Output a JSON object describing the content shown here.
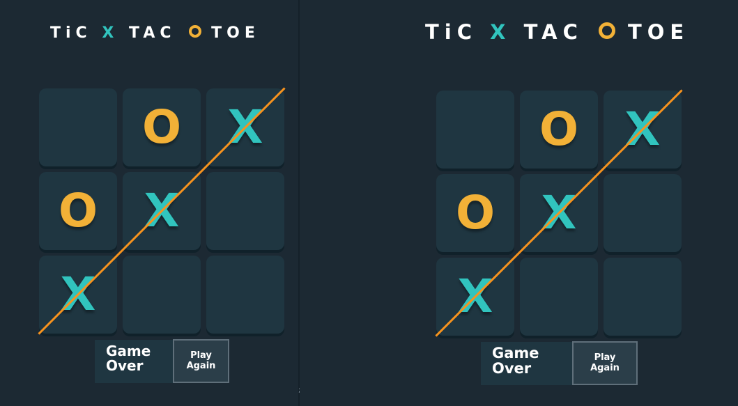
{
  "game": {
    "title": {
      "tic": "TiC",
      "x_mark": "X",
      "tac": "TAC",
      "toe": "TOE"
    },
    "board": [
      "",
      "O",
      "X",
      "O",
      "X",
      "",
      "X",
      "",
      ""
    ],
    "winning_line": [
      6,
      4,
      2
    ],
    "status_text_line1": "Game",
    "status_text_line2": "Over",
    "play_again_line1": "Play",
    "play_again_line2": "Again"
  },
  "stray_mark": ";",
  "colors": {
    "background": "#1c2933",
    "cell": "#1f3641",
    "x": "#31c4be",
    "o": "#f2b137",
    "win_line": "#f7931e"
  }
}
